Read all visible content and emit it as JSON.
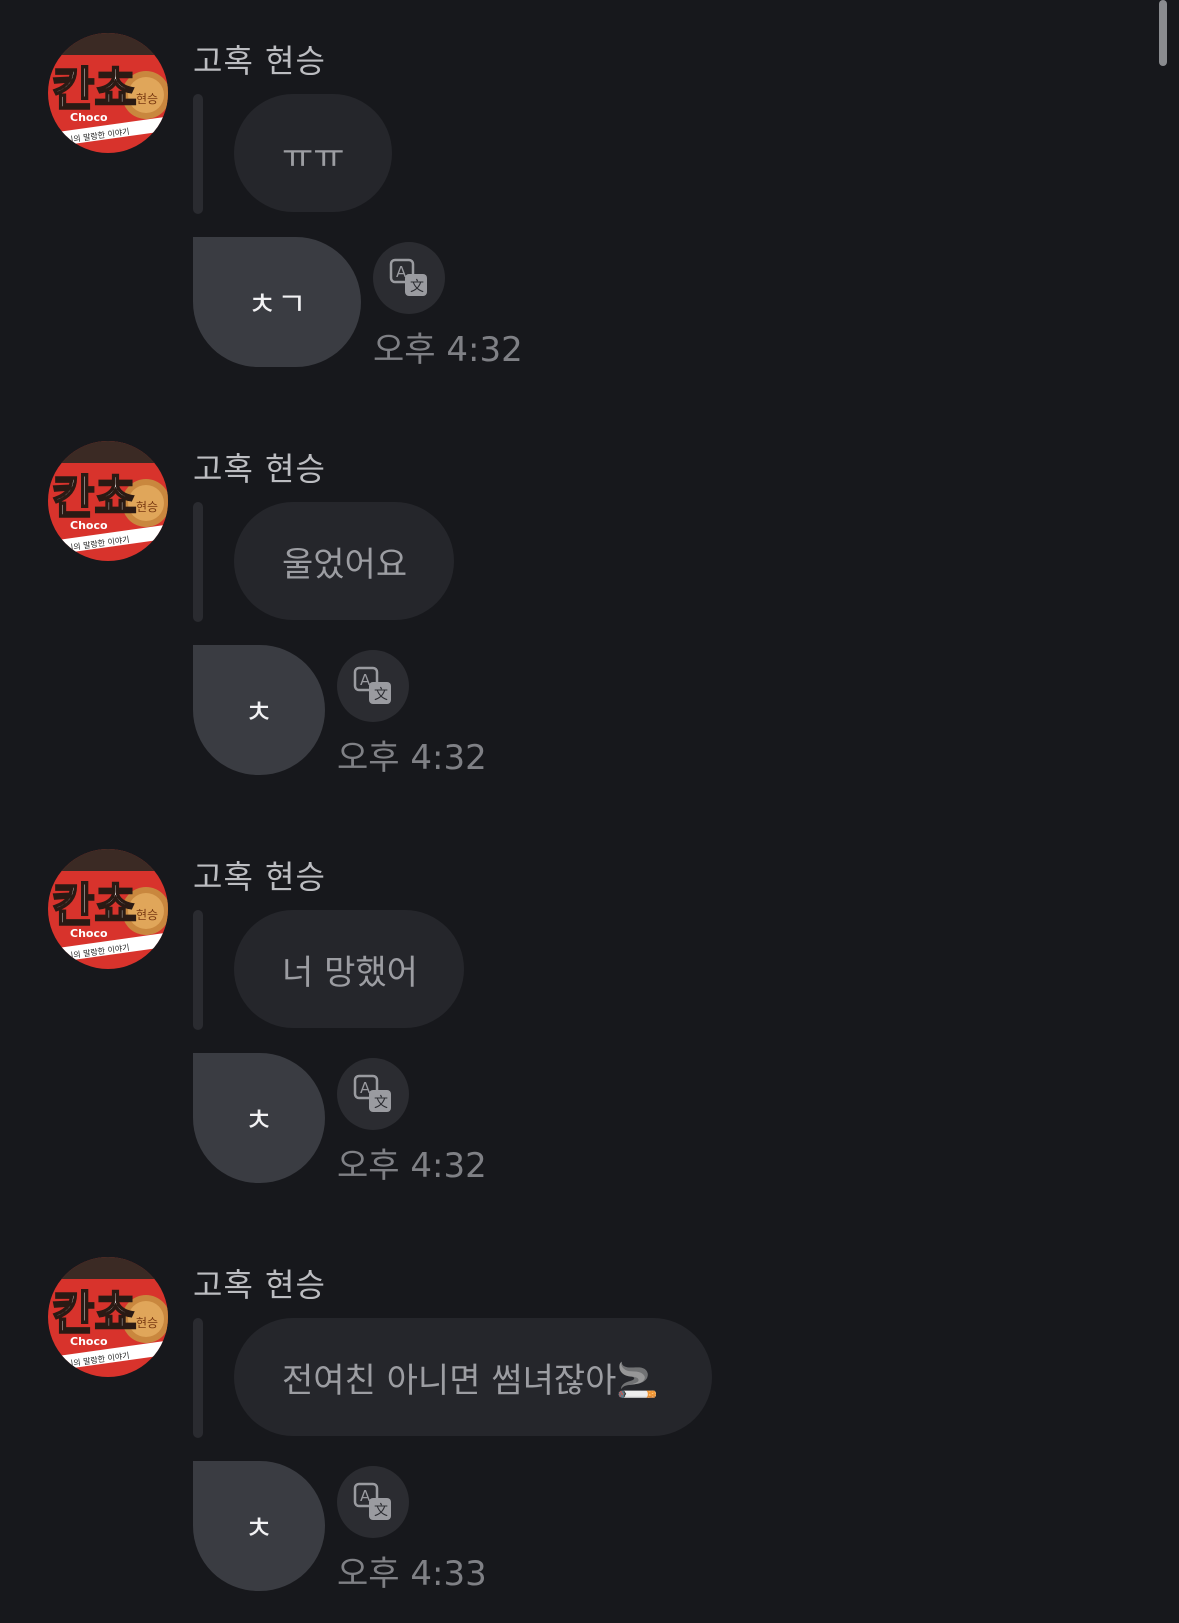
{
  "messages": [
    {
      "sender": "고혹 현승",
      "quoted_text": "ㅠㅠ",
      "reply_text": "ㅊㄱ",
      "time": "오후 4:32",
      "translate_icon": "translate-icon"
    },
    {
      "sender": "고혹 현승",
      "quoted_text": "울었어요",
      "reply_text": "ㅊ",
      "time": "오후 4:32",
      "translate_icon": "translate-icon"
    },
    {
      "sender": "고혹 현승",
      "quoted_text": "너 망했어",
      "reply_text": "ㅊ",
      "time": "오후 4:32",
      "translate_icon": "translate-icon"
    },
    {
      "sender": "고혹 현승",
      "quoted_text": "전여친 아니면 썸녀잖아🚬",
      "reply_text": "ㅊ",
      "time": "오후 4:33",
      "translate_icon": "translate-icon"
    }
  ],
  "avatar": {
    "logo_text": "칸쵸",
    "logo_subtext": "Choco",
    "logo_caption": "코니의 말랑한 이야기",
    "logo_badge": "현승"
  },
  "colors": {
    "background": "#17181c",
    "quoted_bubble": "#25262b",
    "reply_bubble": "#3a3c42",
    "text_primary": "#f2f2f4",
    "text_secondary": "#7f8085"
  }
}
